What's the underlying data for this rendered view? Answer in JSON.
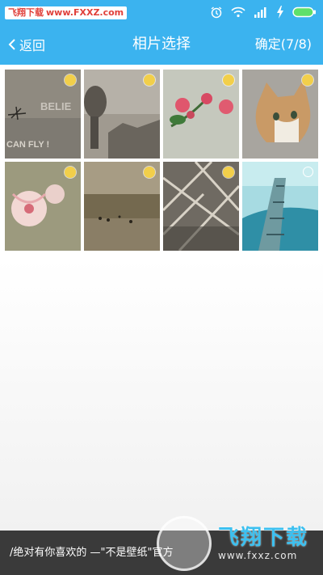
{
  "status_bar": {
    "source_badge_cn": "飞翔下载",
    "source_badge_url": "www.FXXZ.com",
    "icons": [
      "alarm-icon",
      "wifi-icon",
      "signal-icon",
      "charging-icon",
      "battery-icon"
    ]
  },
  "nav": {
    "back_label": "返回",
    "title": "相片选择",
    "confirm_label": "确定(7/8)"
  },
  "photos": [
    {
      "subject": "BELIEVE / CAN FLY text photo",
      "caption_1": "BELIE",
      "caption_2": "CAN FLY !",
      "selected": true
    },
    {
      "subject": "buddha statue",
      "selected": true
    },
    {
      "subject": "pink flowers",
      "selected": true
    },
    {
      "subject": "kitten",
      "selected": true
    },
    {
      "subject": "white lily",
      "selected": true
    },
    {
      "subject": "beach sand",
      "selected": true
    },
    {
      "subject": "rope net",
      "selected": true
    },
    {
      "subject": "pier over sea",
      "selected": false
    }
  ],
  "bottom_bar": {
    "text": "/绝对有你喜欢的 —\"不是壁纸\"官方"
  },
  "watermark": {
    "brand": "飞翔下载",
    "url": "www.fxxz.com"
  },
  "colors": {
    "accent": "#3bb3ef",
    "selected_dot": "#f2cf4a",
    "bottom_bar": "#3a3a3a"
  }
}
